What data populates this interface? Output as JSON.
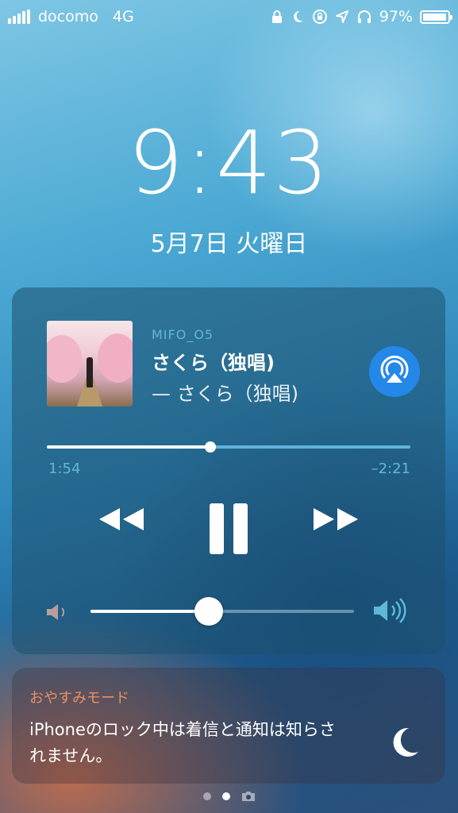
{
  "status_bar": {
    "carrier": "docomo",
    "network": "4G",
    "battery_percent": "97%",
    "battery_level": 0.97,
    "signal_bars": 5,
    "icons": [
      "lock-icon",
      "moon-icon",
      "rotation-lock-icon",
      "location-icon",
      "headphones-icon",
      "battery-icon"
    ]
  },
  "lock": {
    "time": "9:43",
    "date": "5月7日 火曜日"
  },
  "now_playing": {
    "artist": "MIFO_O5",
    "title": "さくら（独唱)",
    "album_line": "— さくら（独唱)",
    "elapsed": "1:54",
    "remaining": "–2:21",
    "progress": 0.45,
    "volume": 0.45,
    "airplay_color": "#2488e8",
    "icons": [
      "rewind-icon",
      "pause-icon",
      "fast-forward-icon",
      "volume-low-icon",
      "volume-high-icon",
      "airplay-icon"
    ]
  },
  "dnd": {
    "title": "おやすみモード",
    "message": "iPhoneのロック中は着信と通知は知らされません。",
    "title_color": "#e79060"
  },
  "pages": {
    "count": 2,
    "current": 1,
    "camera_icon": "camera-icon"
  }
}
